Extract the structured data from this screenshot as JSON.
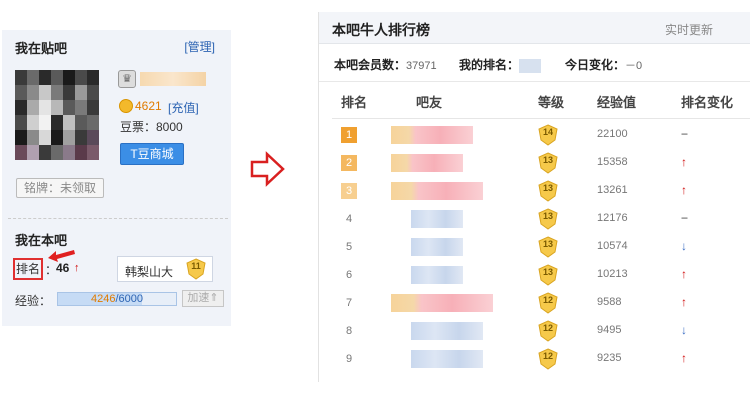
{
  "left_panel": {
    "title": "我在贴吧",
    "manage_link": "[管理]",
    "coin_value": "4621",
    "recharge_link": "[充值]",
    "tdou": "豆票：8000",
    "tmall_button": "T豆商城",
    "badge_button": "铭牌：未领取",
    "section_title": "我在本吧",
    "rank_label": "排名",
    "rank_colon": "：",
    "rank_value": "46",
    "rank_arrow": "↑",
    "bar_name": "韩梨山大",
    "bar_level": "11",
    "exp_label": "经验：",
    "exp_current": "4246",
    "exp_max": "/6000",
    "exp_fraction": 0.708,
    "accel_button": "加速⇑"
  },
  "right_panel": {
    "title": "本吧牛人排行榜",
    "realtime": "实时更新",
    "members_label": "本吧会员数：",
    "members_value": "37971",
    "my_rank_label": "我的排名：",
    "today_change_label": "今日变化：",
    "today_change_value": "－0",
    "columns": [
      "排名",
      "吧友",
      "等级",
      "经验值",
      "排名变化"
    ],
    "rows": [
      {
        "rank": "1",
        "level": "14",
        "exp": "22100",
        "change": "−",
        "dir": "same"
      },
      {
        "rank": "2",
        "level": "13",
        "exp": "15358",
        "change": "↑",
        "dir": "up"
      },
      {
        "rank": "3",
        "level": "13",
        "exp": "13261",
        "change": "↑",
        "dir": "up"
      },
      {
        "rank": "4",
        "level": "13",
        "exp": "12176",
        "change": "−",
        "dir": "same"
      },
      {
        "rank": "5",
        "level": "13",
        "exp": "10574",
        "change": "↓",
        "dir": "down"
      },
      {
        "rank": "6",
        "level": "13",
        "exp": "10213",
        "change": "↑",
        "dir": "up"
      },
      {
        "rank": "7",
        "level": "12",
        "exp": "9588",
        "change": "↑",
        "dir": "up"
      },
      {
        "rank": "8",
        "level": "12",
        "exp": "9495",
        "change": "↓",
        "dir": "down"
      },
      {
        "rank": "9",
        "level": "12",
        "exp": "9235",
        "change": "↑",
        "dir": "up"
      }
    ]
  },
  "colors": {
    "link_blue": "#2d64b3",
    "up_red": "#d01010",
    "down_blue": "#3b6dc4",
    "medal_orange": "#f0a030",
    "level_gold": "#f6c94a"
  },
  "icons": [
    "crown-icon",
    "coin-icon",
    "up-arrow-icon",
    "down-arrow-icon",
    "level-shield-icon",
    "hollow-right-arrow-icon",
    "red-pointer-arrow-icon"
  ]
}
